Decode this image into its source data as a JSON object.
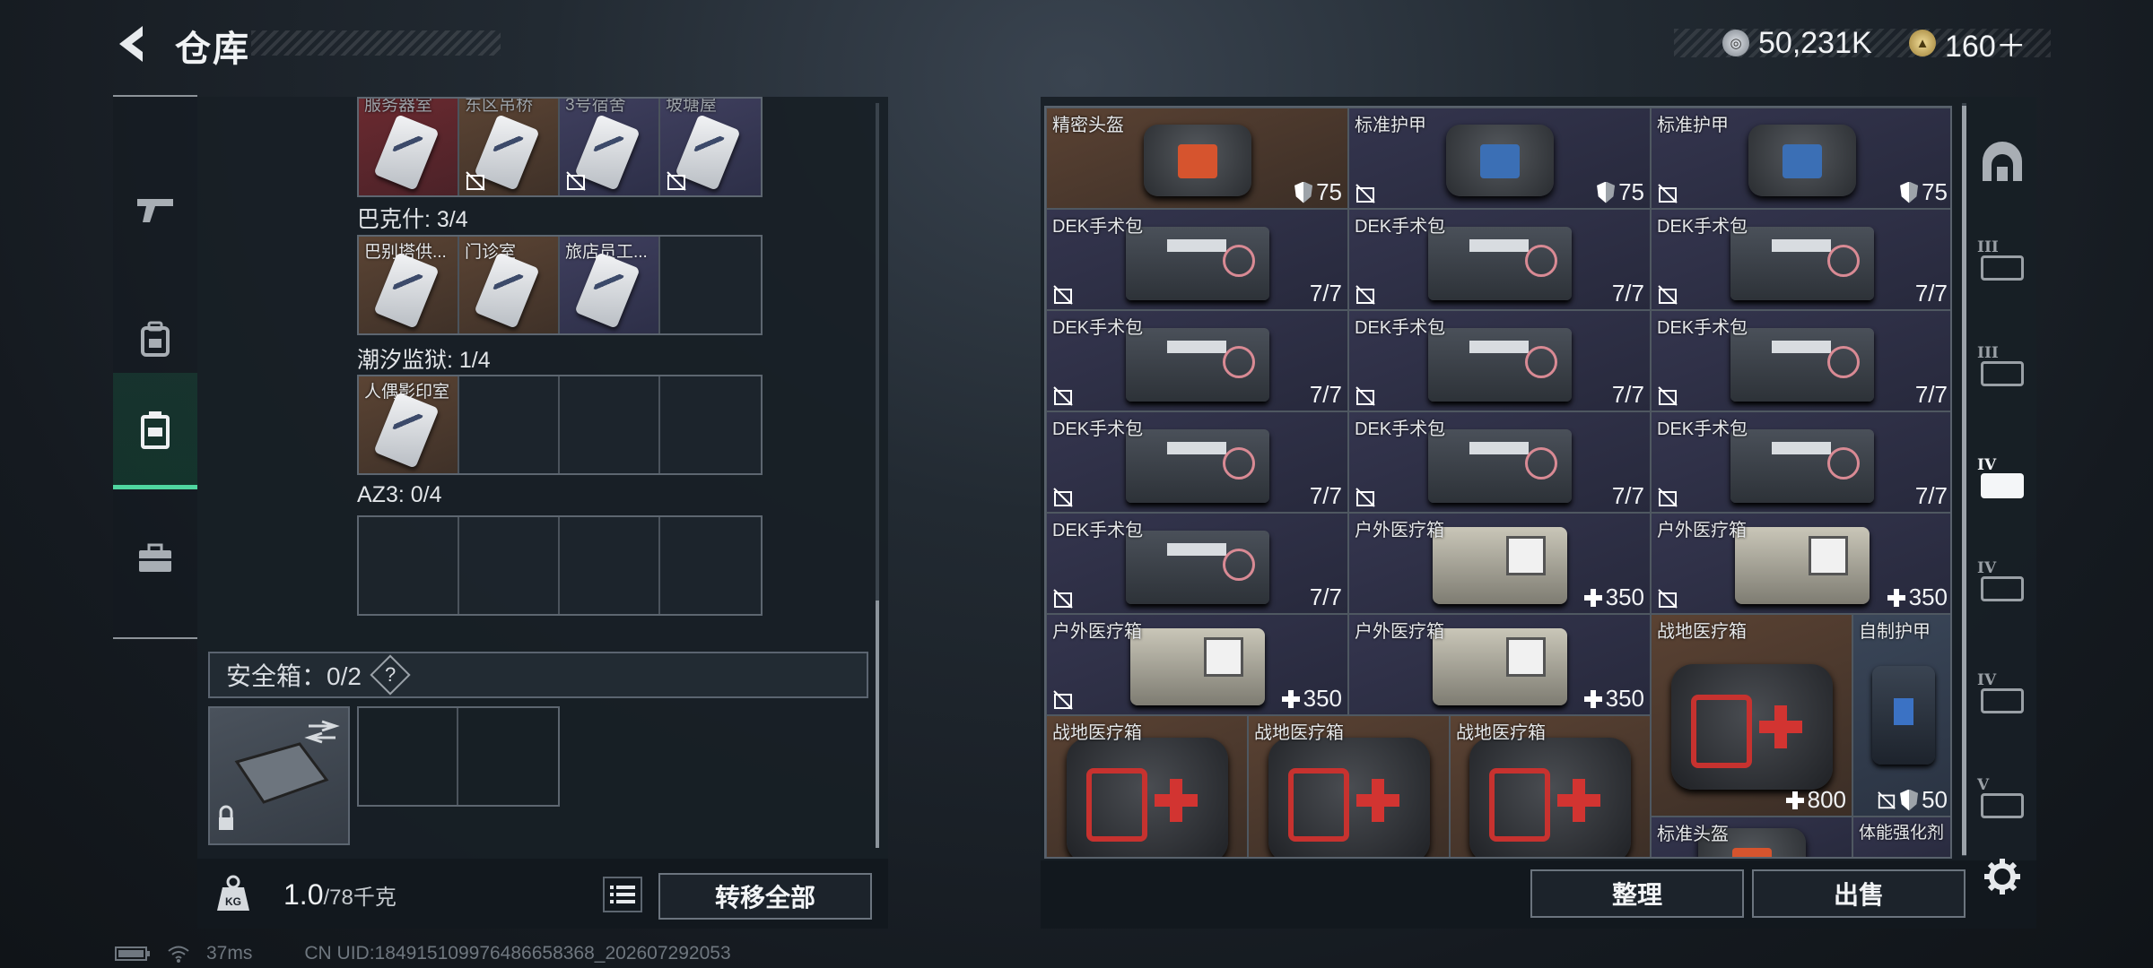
{
  "header": {
    "title": "仓库"
  },
  "currency": [
    {
      "icon": "silver-coin-icon",
      "value": "50,231K",
      "color": "#b8bec6"
    },
    {
      "icon": "gold-coin-icon",
      "value": "160＋",
      "color": "#d2b568"
    }
  ],
  "left_nav": [
    {
      "icon": "pistol-icon",
      "active": false
    },
    {
      "icon": "backpack-icon",
      "active": false
    },
    {
      "icon": "storage-case-icon",
      "active": true
    },
    {
      "icon": "toolbox-icon",
      "active": false
    }
  ],
  "keycards": {
    "top_row": [
      "服务器室",
      "东区吊桥",
      "3号宿舍",
      "坡塘屋"
    ],
    "sections": [
      {
        "label": "巴克什: 3/4",
        "cards": [
          "巴别塔供...",
          "门诊室",
          "旅店员工...",
          ""
        ]
      },
      {
        "label": "潮汐监狱: 1/4",
        "cards": [
          "人偶影印室",
          "",
          "",
          ""
        ]
      },
      {
        "label": "AZ3: 0/4",
        "cards": [
          "",
          "",
          "",
          ""
        ]
      }
    ]
  },
  "safe_box": {
    "label": "安全箱：0/2",
    "help": "?"
  },
  "footer": {
    "weight_icon": "KG",
    "weight_value": "1.0",
    "weight_max": "/78千克",
    "transfer_label": "转移全部"
  },
  "inventory": [
    {
      "name": "精密头盔",
      "value": "75",
      "kind": "helmet"
    },
    {
      "name": "标准护甲",
      "value": "75",
      "kind": "armor"
    },
    {
      "name": "标准护甲",
      "value": "75",
      "kind": "armor"
    },
    {
      "name": "DEK手术包",
      "value": "7/7",
      "kind": "kit"
    },
    {
      "name": "DEK手术包",
      "value": "7/7",
      "kind": "kit"
    },
    {
      "name": "DEK手术包",
      "value": "7/7",
      "kind": "kit"
    },
    {
      "name": "DEK手术包",
      "value": "7/7",
      "kind": "kit"
    },
    {
      "name": "DEK手术包",
      "value": "7/7",
      "kind": "kit"
    },
    {
      "name": "DEK手术包",
      "value": "7/7",
      "kind": "kit"
    },
    {
      "name": "DEK手术包",
      "value": "7/7",
      "kind": "kit"
    },
    {
      "name": "DEK手术包",
      "value": "7/7",
      "kind": "kit"
    },
    {
      "name": "DEK手术包",
      "value": "7/7",
      "kind": "kit"
    },
    {
      "name": "DEK手术包",
      "value": "7/7",
      "kind": "kit"
    },
    {
      "name": "户外医疗箱",
      "value": "350",
      "kind": "box"
    },
    {
      "name": "户外医疗箱",
      "value": "350",
      "kind": "box"
    },
    {
      "name": "户外医疗箱",
      "value": "350",
      "kind": "box"
    },
    {
      "name": "户外医疗箱",
      "value": "350",
      "kind": "box"
    },
    {
      "name": "战地医疗箱",
      "value": "800",
      "kind": "bigkit"
    },
    {
      "name": "自制护甲",
      "value": "50",
      "kind": "vest"
    },
    {
      "name": "战地医疗箱",
      "value": "",
      "kind": "bigkit"
    },
    {
      "name": "战地医疗箱",
      "value": "",
      "kind": "bigkit"
    },
    {
      "name": "战地医疗箱",
      "value": "",
      "kind": "bigkit"
    },
    {
      "name": "标准头盔",
      "value": "",
      "kind": "helmet"
    },
    {
      "name": "体能强化剂",
      "value": "",
      "kind": "syringe"
    }
  ],
  "right_footer": {
    "sort_label": "整理",
    "sell_label": "出售"
  },
  "side_nav": [
    {
      "icon": "dome-icon",
      "tier": ""
    },
    {
      "icon": "tier-3-case-icon",
      "tier": "III"
    },
    {
      "icon": "tier-3-case-alt-icon",
      "tier": "III"
    },
    {
      "icon": "tier-4-medkit-icon",
      "tier": "IV"
    },
    {
      "icon": "tier-4-medkit-alt-icon",
      "tier": "IV"
    },
    {
      "icon": "tier-4-folder-icon",
      "tier": "IV"
    },
    {
      "icon": "tier-5-case-icon",
      "tier": "V"
    }
  ],
  "status": {
    "ping": "37ms",
    "uid": "CN UID:1849151099764866583​68_202607292053"
  }
}
